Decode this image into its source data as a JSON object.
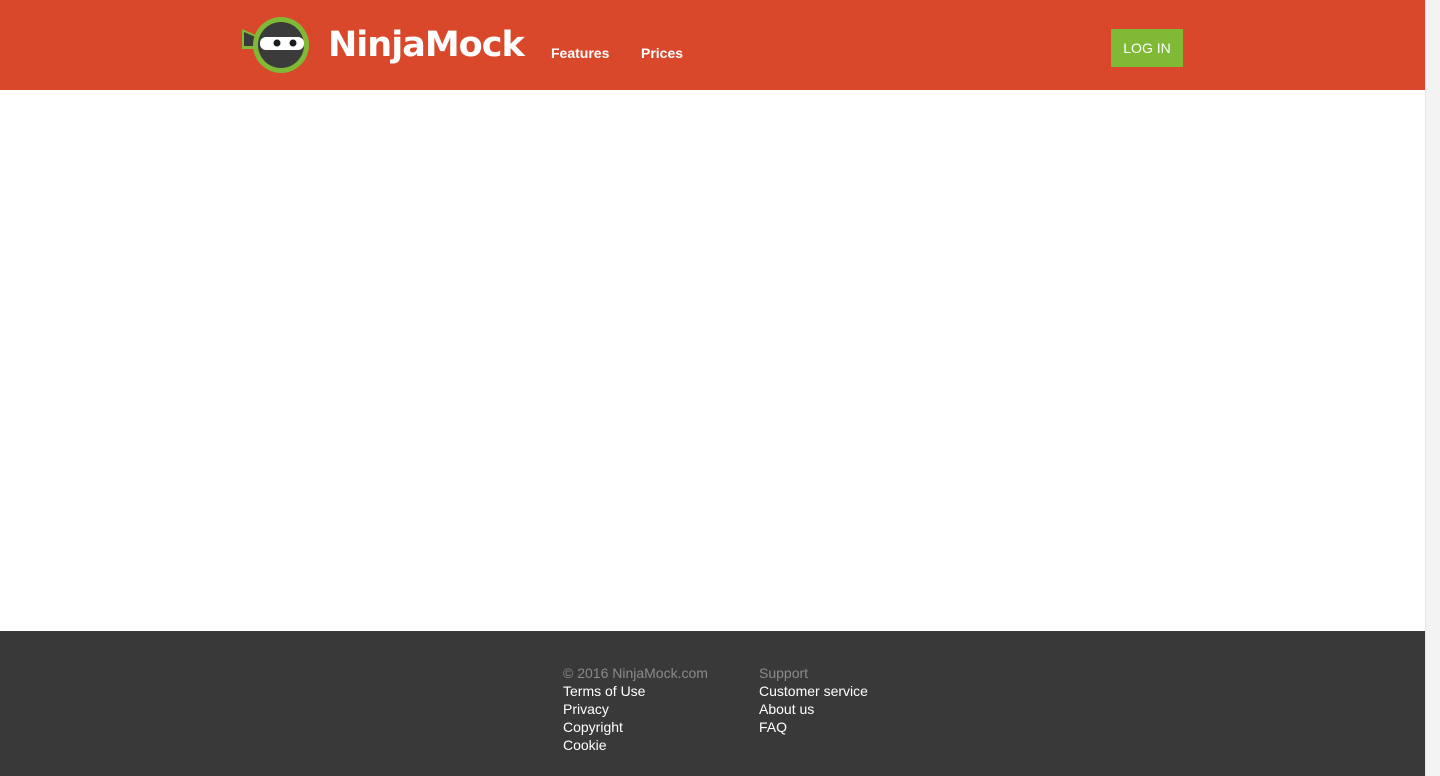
{
  "header": {
    "logo_text": "NinjaMock",
    "nav": [
      {
        "label": "Features"
      },
      {
        "label": "Prices"
      }
    ],
    "login_label": "LOG IN"
  },
  "footer": {
    "left": {
      "heading": "© 2016 NinjaMock.com",
      "links": [
        "Terms of Use",
        "Privacy",
        "Copyright",
        "Cookie"
      ]
    },
    "right": {
      "heading": "Support",
      "links": [
        "Customer service",
        "About us",
        "FAQ"
      ]
    }
  },
  "colors": {
    "header_bg": "#d9482b",
    "login_bg": "#7fb935",
    "footer_bg": "#393939"
  },
  "icons": {
    "logo": "ninja-logo-icon"
  }
}
